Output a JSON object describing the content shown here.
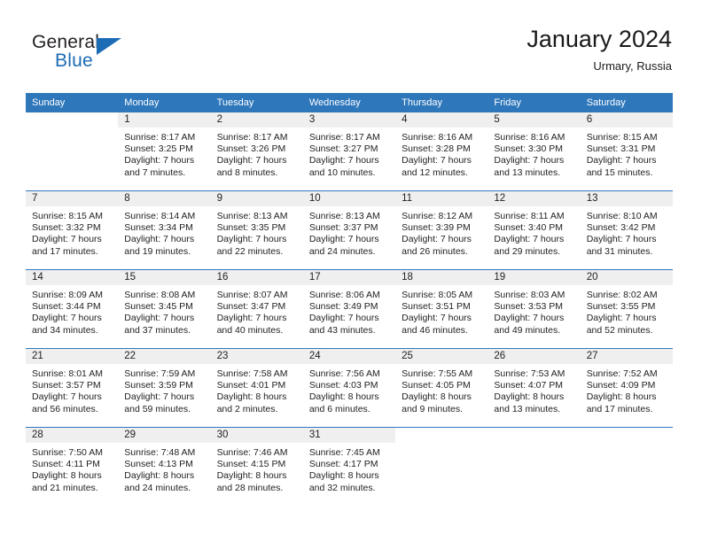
{
  "brand": {
    "line1": "General",
    "line2": "Blue",
    "logo_icon": "triangle-icon",
    "accent_color": "#1b6cb5"
  },
  "header": {
    "title": "January 2024",
    "location": "Urmary, Russia"
  },
  "theme": {
    "header_bg": "#2e77bb",
    "daynum_bg": "#efefef",
    "grid_line": "#2e77bb",
    "text": "#222222"
  },
  "weekday_headers": [
    "Sunday",
    "Monday",
    "Tuesday",
    "Wednesday",
    "Thursday",
    "Friday",
    "Saturday"
  ],
  "weeks": [
    [
      {
        "day": "",
        "blank": true,
        "lines": []
      },
      {
        "day": "1",
        "lines": [
          "Sunrise: 8:17 AM",
          "Sunset: 3:25 PM",
          "Daylight: 7 hours",
          "and 7 minutes."
        ]
      },
      {
        "day": "2",
        "lines": [
          "Sunrise: 8:17 AM",
          "Sunset: 3:26 PM",
          "Daylight: 7 hours",
          "and 8 minutes."
        ]
      },
      {
        "day": "3",
        "lines": [
          "Sunrise: 8:17 AM",
          "Sunset: 3:27 PM",
          "Daylight: 7 hours",
          "and 10 minutes."
        ]
      },
      {
        "day": "4",
        "lines": [
          "Sunrise: 8:16 AM",
          "Sunset: 3:28 PM",
          "Daylight: 7 hours",
          "and 12 minutes."
        ]
      },
      {
        "day": "5",
        "lines": [
          "Sunrise: 8:16 AM",
          "Sunset: 3:30 PM",
          "Daylight: 7 hours",
          "and 13 minutes."
        ]
      },
      {
        "day": "6",
        "lines": [
          "Sunrise: 8:15 AM",
          "Sunset: 3:31 PM",
          "Daylight: 7 hours",
          "and 15 minutes."
        ]
      }
    ],
    [
      {
        "day": "7",
        "lines": [
          "Sunrise: 8:15 AM",
          "Sunset: 3:32 PM",
          "Daylight: 7 hours",
          "and 17 minutes."
        ]
      },
      {
        "day": "8",
        "lines": [
          "Sunrise: 8:14 AM",
          "Sunset: 3:34 PM",
          "Daylight: 7 hours",
          "and 19 minutes."
        ]
      },
      {
        "day": "9",
        "lines": [
          "Sunrise: 8:13 AM",
          "Sunset: 3:35 PM",
          "Daylight: 7 hours",
          "and 22 minutes."
        ]
      },
      {
        "day": "10",
        "lines": [
          "Sunrise: 8:13 AM",
          "Sunset: 3:37 PM",
          "Daylight: 7 hours",
          "and 24 minutes."
        ]
      },
      {
        "day": "11",
        "lines": [
          "Sunrise: 8:12 AM",
          "Sunset: 3:39 PM",
          "Daylight: 7 hours",
          "and 26 minutes."
        ]
      },
      {
        "day": "12",
        "lines": [
          "Sunrise: 8:11 AM",
          "Sunset: 3:40 PM",
          "Daylight: 7 hours",
          "and 29 minutes."
        ]
      },
      {
        "day": "13",
        "lines": [
          "Sunrise: 8:10 AM",
          "Sunset: 3:42 PM",
          "Daylight: 7 hours",
          "and 31 minutes."
        ]
      }
    ],
    [
      {
        "day": "14",
        "lines": [
          "Sunrise: 8:09 AM",
          "Sunset: 3:44 PM",
          "Daylight: 7 hours",
          "and 34 minutes."
        ]
      },
      {
        "day": "15",
        "lines": [
          "Sunrise: 8:08 AM",
          "Sunset: 3:45 PM",
          "Daylight: 7 hours",
          "and 37 minutes."
        ]
      },
      {
        "day": "16",
        "lines": [
          "Sunrise: 8:07 AM",
          "Sunset: 3:47 PM",
          "Daylight: 7 hours",
          "and 40 minutes."
        ]
      },
      {
        "day": "17",
        "lines": [
          "Sunrise: 8:06 AM",
          "Sunset: 3:49 PM",
          "Daylight: 7 hours",
          "and 43 minutes."
        ]
      },
      {
        "day": "18",
        "lines": [
          "Sunrise: 8:05 AM",
          "Sunset: 3:51 PM",
          "Daylight: 7 hours",
          "and 46 minutes."
        ]
      },
      {
        "day": "19",
        "lines": [
          "Sunrise: 8:03 AM",
          "Sunset: 3:53 PM",
          "Daylight: 7 hours",
          "and 49 minutes."
        ]
      },
      {
        "day": "20",
        "lines": [
          "Sunrise: 8:02 AM",
          "Sunset: 3:55 PM",
          "Daylight: 7 hours",
          "and 52 minutes."
        ]
      }
    ],
    [
      {
        "day": "21",
        "lines": [
          "Sunrise: 8:01 AM",
          "Sunset: 3:57 PM",
          "Daylight: 7 hours",
          "and 56 minutes."
        ]
      },
      {
        "day": "22",
        "lines": [
          "Sunrise: 7:59 AM",
          "Sunset: 3:59 PM",
          "Daylight: 7 hours",
          "and 59 minutes."
        ]
      },
      {
        "day": "23",
        "lines": [
          "Sunrise: 7:58 AM",
          "Sunset: 4:01 PM",
          "Daylight: 8 hours",
          "and 2 minutes."
        ]
      },
      {
        "day": "24",
        "lines": [
          "Sunrise: 7:56 AM",
          "Sunset: 4:03 PM",
          "Daylight: 8 hours",
          "and 6 minutes."
        ]
      },
      {
        "day": "25",
        "lines": [
          "Sunrise: 7:55 AM",
          "Sunset: 4:05 PM",
          "Daylight: 8 hours",
          "and 9 minutes."
        ]
      },
      {
        "day": "26",
        "lines": [
          "Sunrise: 7:53 AM",
          "Sunset: 4:07 PM",
          "Daylight: 8 hours",
          "and 13 minutes."
        ]
      },
      {
        "day": "27",
        "lines": [
          "Sunrise: 7:52 AM",
          "Sunset: 4:09 PM",
          "Daylight: 8 hours",
          "and 17 minutes."
        ]
      }
    ],
    [
      {
        "day": "28",
        "lines": [
          "Sunrise: 7:50 AM",
          "Sunset: 4:11 PM",
          "Daylight: 8 hours",
          "and 21 minutes."
        ]
      },
      {
        "day": "29",
        "lines": [
          "Sunrise: 7:48 AM",
          "Sunset: 4:13 PM",
          "Daylight: 8 hours",
          "and 24 minutes."
        ]
      },
      {
        "day": "30",
        "lines": [
          "Sunrise: 7:46 AM",
          "Sunset: 4:15 PM",
          "Daylight: 8 hours",
          "and 28 minutes."
        ]
      },
      {
        "day": "31",
        "lines": [
          "Sunrise: 7:45 AM",
          "Sunset: 4:17 PM",
          "Daylight: 8 hours",
          "and 32 minutes."
        ]
      },
      {
        "day": "",
        "blank": true,
        "lines": []
      },
      {
        "day": "",
        "blank": true,
        "lines": []
      },
      {
        "day": "",
        "blank": true,
        "lines": []
      }
    ]
  ]
}
